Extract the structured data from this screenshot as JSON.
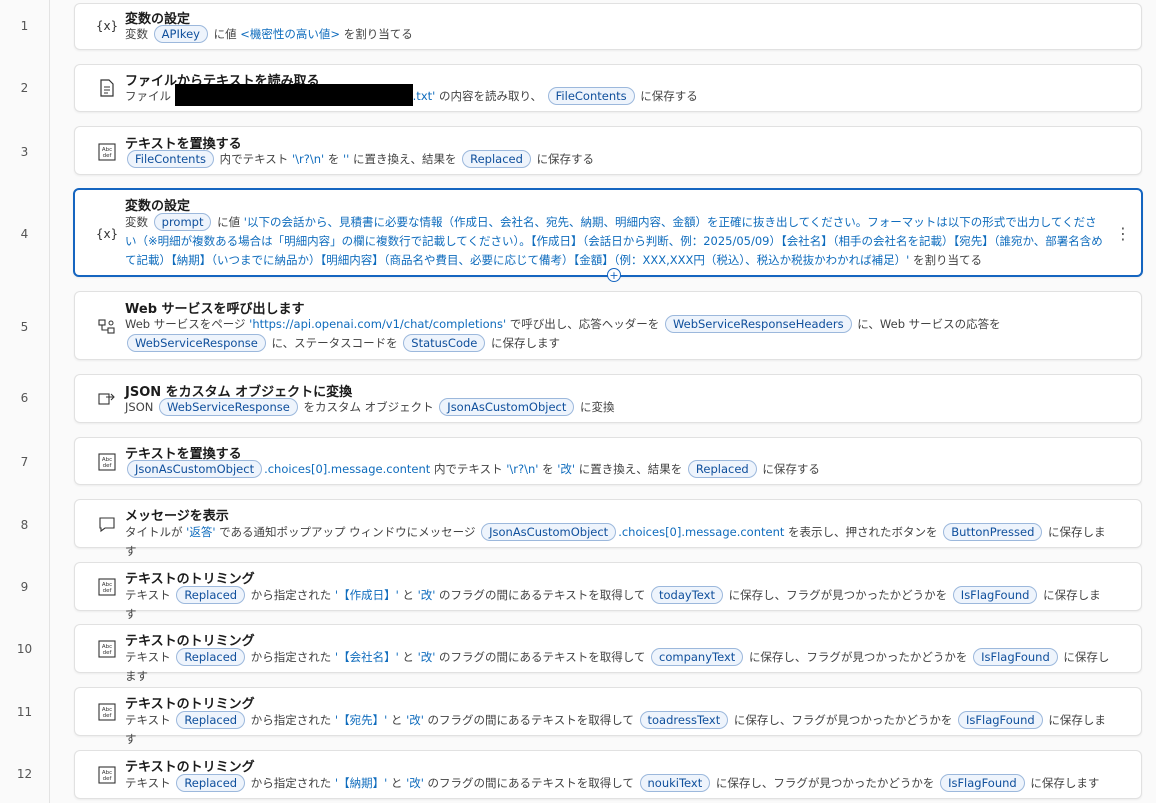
{
  "line_numbers": [
    "1",
    "2",
    "3",
    "4",
    "5",
    "6",
    "7",
    "8",
    "9",
    "10",
    "11",
    "12"
  ],
  "steps": [
    {
      "title": "変数の設定",
      "desc": [
        "変数",
        "APIkey",
        "に値",
        "<機密性の高い値>",
        "を割り当てる"
      ]
    },
    {
      "title": "ファイルからテキストを読み取る",
      "desc": [
        "ファイル",
        ".txt'",
        "の内容を読み取り、",
        "FileContents",
        "に保存する"
      ]
    },
    {
      "title": "テキストを置換する",
      "desc": [
        "FileContents",
        "内でテキスト",
        "'\\r?\\n'",
        "を",
        "''",
        "に置き換え、結果を",
        "Replaced",
        "に保存する"
      ]
    },
    {
      "title": "変数の設定",
      "desc": [
        "変数",
        "prompt",
        "に値",
        "'以下の会話から、見積書に必要な情報（作成日、会社名、宛先、納期、明細内容、金額）を正確に抜き出してください。フォーマットは以下の形式で出力してください（※明細が複数ある場合は「明細内容」の欄に複数行で記載してください）。【作成日】（会話日から判断、例：2025/05/09）【会社名】（相手の会社名を記載）【宛先】（誰宛か、部署名含めて記載）【納期】（いつまでに納品か）【明細内容】（商品名や費目、必要に応じて備考）【金額】（例：XXX,XXX円（税込）、税込か税抜かわかれば補足）'",
        "を割り当てる"
      ]
    },
    {
      "title": "Web サービスを呼び出します",
      "desc": [
        "Web サービスをページ",
        "'https://api.openai.com/v1/chat/completions'",
        "で呼び出し、応答ヘッダーを",
        "WebServiceResponseHeaders",
        "に、Web サービスの応答を",
        "WebServiceResponse",
        "に、ステータスコードを",
        "StatusCode",
        "に保存します"
      ]
    },
    {
      "title": "JSON をカスタム オブジェクトに変換",
      "desc": [
        "JSON",
        "WebServiceResponse",
        "をカスタム オブジェクト",
        "JsonAsCustomObject",
        "に変換"
      ]
    },
    {
      "title": "テキストを置換する",
      "desc": [
        "JsonAsCustomObject",
        ".choices[0].message.content",
        "内でテキスト",
        "'\\r?\\n'",
        "を",
        "'改'",
        "に置き換え、結果を",
        "Replaced",
        "に保存する"
      ]
    },
    {
      "title": "メッセージを表示",
      "desc": [
        "タイトルが",
        "'返答'",
        "である通知ポップアップ ウィンドウにメッセージ",
        "JsonAsCustomObject",
        ".choices[0].message.content",
        "を表示し、押されたボタンを",
        "ButtonPressed",
        "に保存します"
      ]
    },
    {
      "title": "テキストのトリミング",
      "desc": [
        "テキスト",
        "Replaced",
        "から指定された",
        "'【作成日】'",
        "と",
        "'改'",
        "のフラグの間にあるテキストを取得して",
        "todayText",
        "に保存し、フラグが見つかったかどうかを",
        "IsFlagFound",
        "に保存します"
      ]
    },
    {
      "title": "テキストのトリミング",
      "desc": [
        "テキスト",
        "Replaced",
        "から指定された",
        "'【会社名】'",
        "と",
        "'改'",
        "のフラグの間にあるテキストを取得して",
        "companyText",
        "に保存し、フラグが見つかったかどうかを",
        "IsFlagFound",
        "に保存します"
      ]
    },
    {
      "title": "テキストのトリミング",
      "desc": [
        "テキスト",
        "Replaced",
        "から指定された",
        "'【宛先】'",
        "と",
        "'改'",
        "のフラグの間にあるテキストを取得して",
        "toadressText",
        "に保存し、フラグが見つかったかどうかを",
        "IsFlagFound",
        "に保存します"
      ]
    },
    {
      "title": "テキストのトリミング",
      "desc": [
        "テキスト",
        "Replaced",
        "から指定された",
        "'【納期】'",
        "と",
        "'改'",
        "のフラグの間にあるテキストを取得して",
        "noukiText",
        "に保存し、フラグが見つかったかどうかを",
        "IsFlagFound",
        "に保存します"
      ]
    }
  ],
  "icons": [
    "variable-icon",
    "file-read-icon",
    "text-replace-icon",
    "variable-icon",
    "web-service-icon",
    "json-convert-icon",
    "text-replace-icon",
    "message-icon",
    "text-trim-icon",
    "text-trim-icon",
    "text-trim-icon",
    "text-trim-icon"
  ],
  "icon_glyphs": {
    "variable": "{x}",
    "text": "Abc def",
    "kebab": "⋮",
    "add": "+"
  },
  "colors": {
    "selected_border": "#1565c0",
    "pill_bg": "#eef4fc",
    "pill_border": "#9cb8dc",
    "literal_text": "#0f6cbd"
  }
}
